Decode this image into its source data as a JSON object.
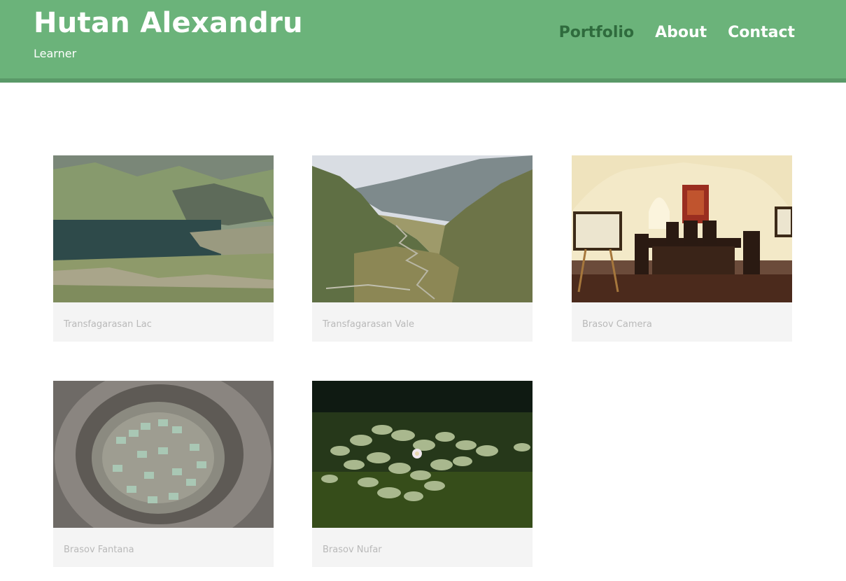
{
  "header": {
    "title": "Hutan Alexandru",
    "tagline": "Learner",
    "colors": {
      "background": "#6bb37a",
      "active_link": "#2f6b3d",
      "link": "#ffffff"
    }
  },
  "nav": {
    "items": [
      {
        "label": "Portfolio",
        "active": true
      },
      {
        "label": "About",
        "active": false
      },
      {
        "label": "Contact",
        "active": false
      }
    ]
  },
  "portfolio": {
    "items": [
      {
        "caption": "Transfagarasan Lac"
      },
      {
        "caption": "Transfagarasan Vale"
      },
      {
        "caption": "Brasov Camera"
      },
      {
        "caption": "Brasov Fantana"
      },
      {
        "caption": "Brasov Nufar"
      }
    ]
  }
}
